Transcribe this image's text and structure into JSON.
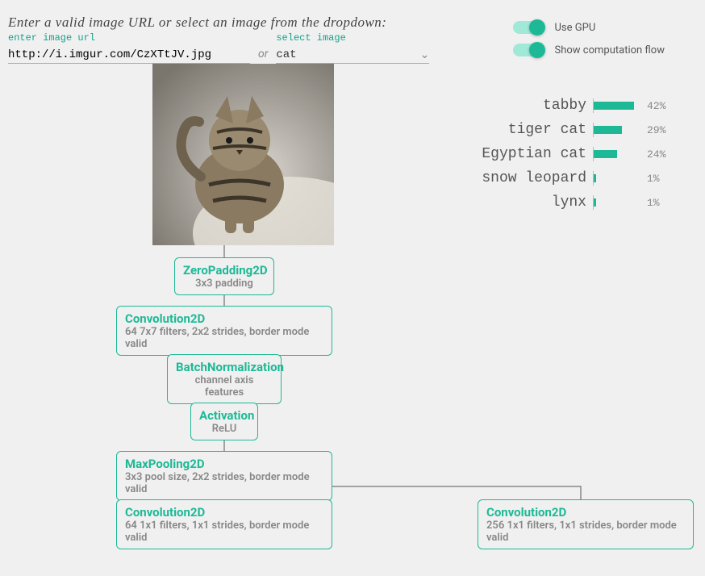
{
  "header": {
    "instruction": "Enter a valid image URL or select an image from the dropdown:",
    "url_label": "enter image url",
    "url_value": "http://i.imgur.com/CzXTtJV.jpg",
    "or_word": "or",
    "select_label": "select image",
    "select_value": "cat"
  },
  "toggles": {
    "gpu": {
      "label": "Use GPU",
      "on": true
    },
    "flow": {
      "label": "Show computation flow",
      "on": true
    }
  },
  "predictions": [
    {
      "label": "tabby",
      "pct": 42,
      "pct_str": "42%"
    },
    {
      "label": "tiger cat",
      "pct": 29,
      "pct_str": "29%"
    },
    {
      "label": "Egyptian cat",
      "pct": 24,
      "pct_str": "24%"
    },
    {
      "label": "snow leopard",
      "pct": 1,
      "pct_str": "1%"
    },
    {
      "label": "lynx",
      "pct": 1,
      "pct_str": "1%"
    }
  ],
  "nodes": [
    {
      "title": "ZeroPadding2D",
      "sub": "3x3 padding"
    },
    {
      "title": "Convolution2D",
      "sub": "64 7x7 filters, 2x2 strides, border mode valid"
    },
    {
      "title": "BatchNormalization",
      "sub": "channel axis features"
    },
    {
      "title": "Activation",
      "sub": "ReLU"
    },
    {
      "title": "MaxPooling2D",
      "sub": "3x3 pool size, 2x2 strides, border mode valid"
    },
    {
      "title": "Convolution2D",
      "sub": "64 1x1 filters, 1x1 strides, border mode valid"
    },
    {
      "title": "Convolution2D",
      "sub": "256 1x1 filters, 1x1 strides, border mode valid"
    }
  ]
}
